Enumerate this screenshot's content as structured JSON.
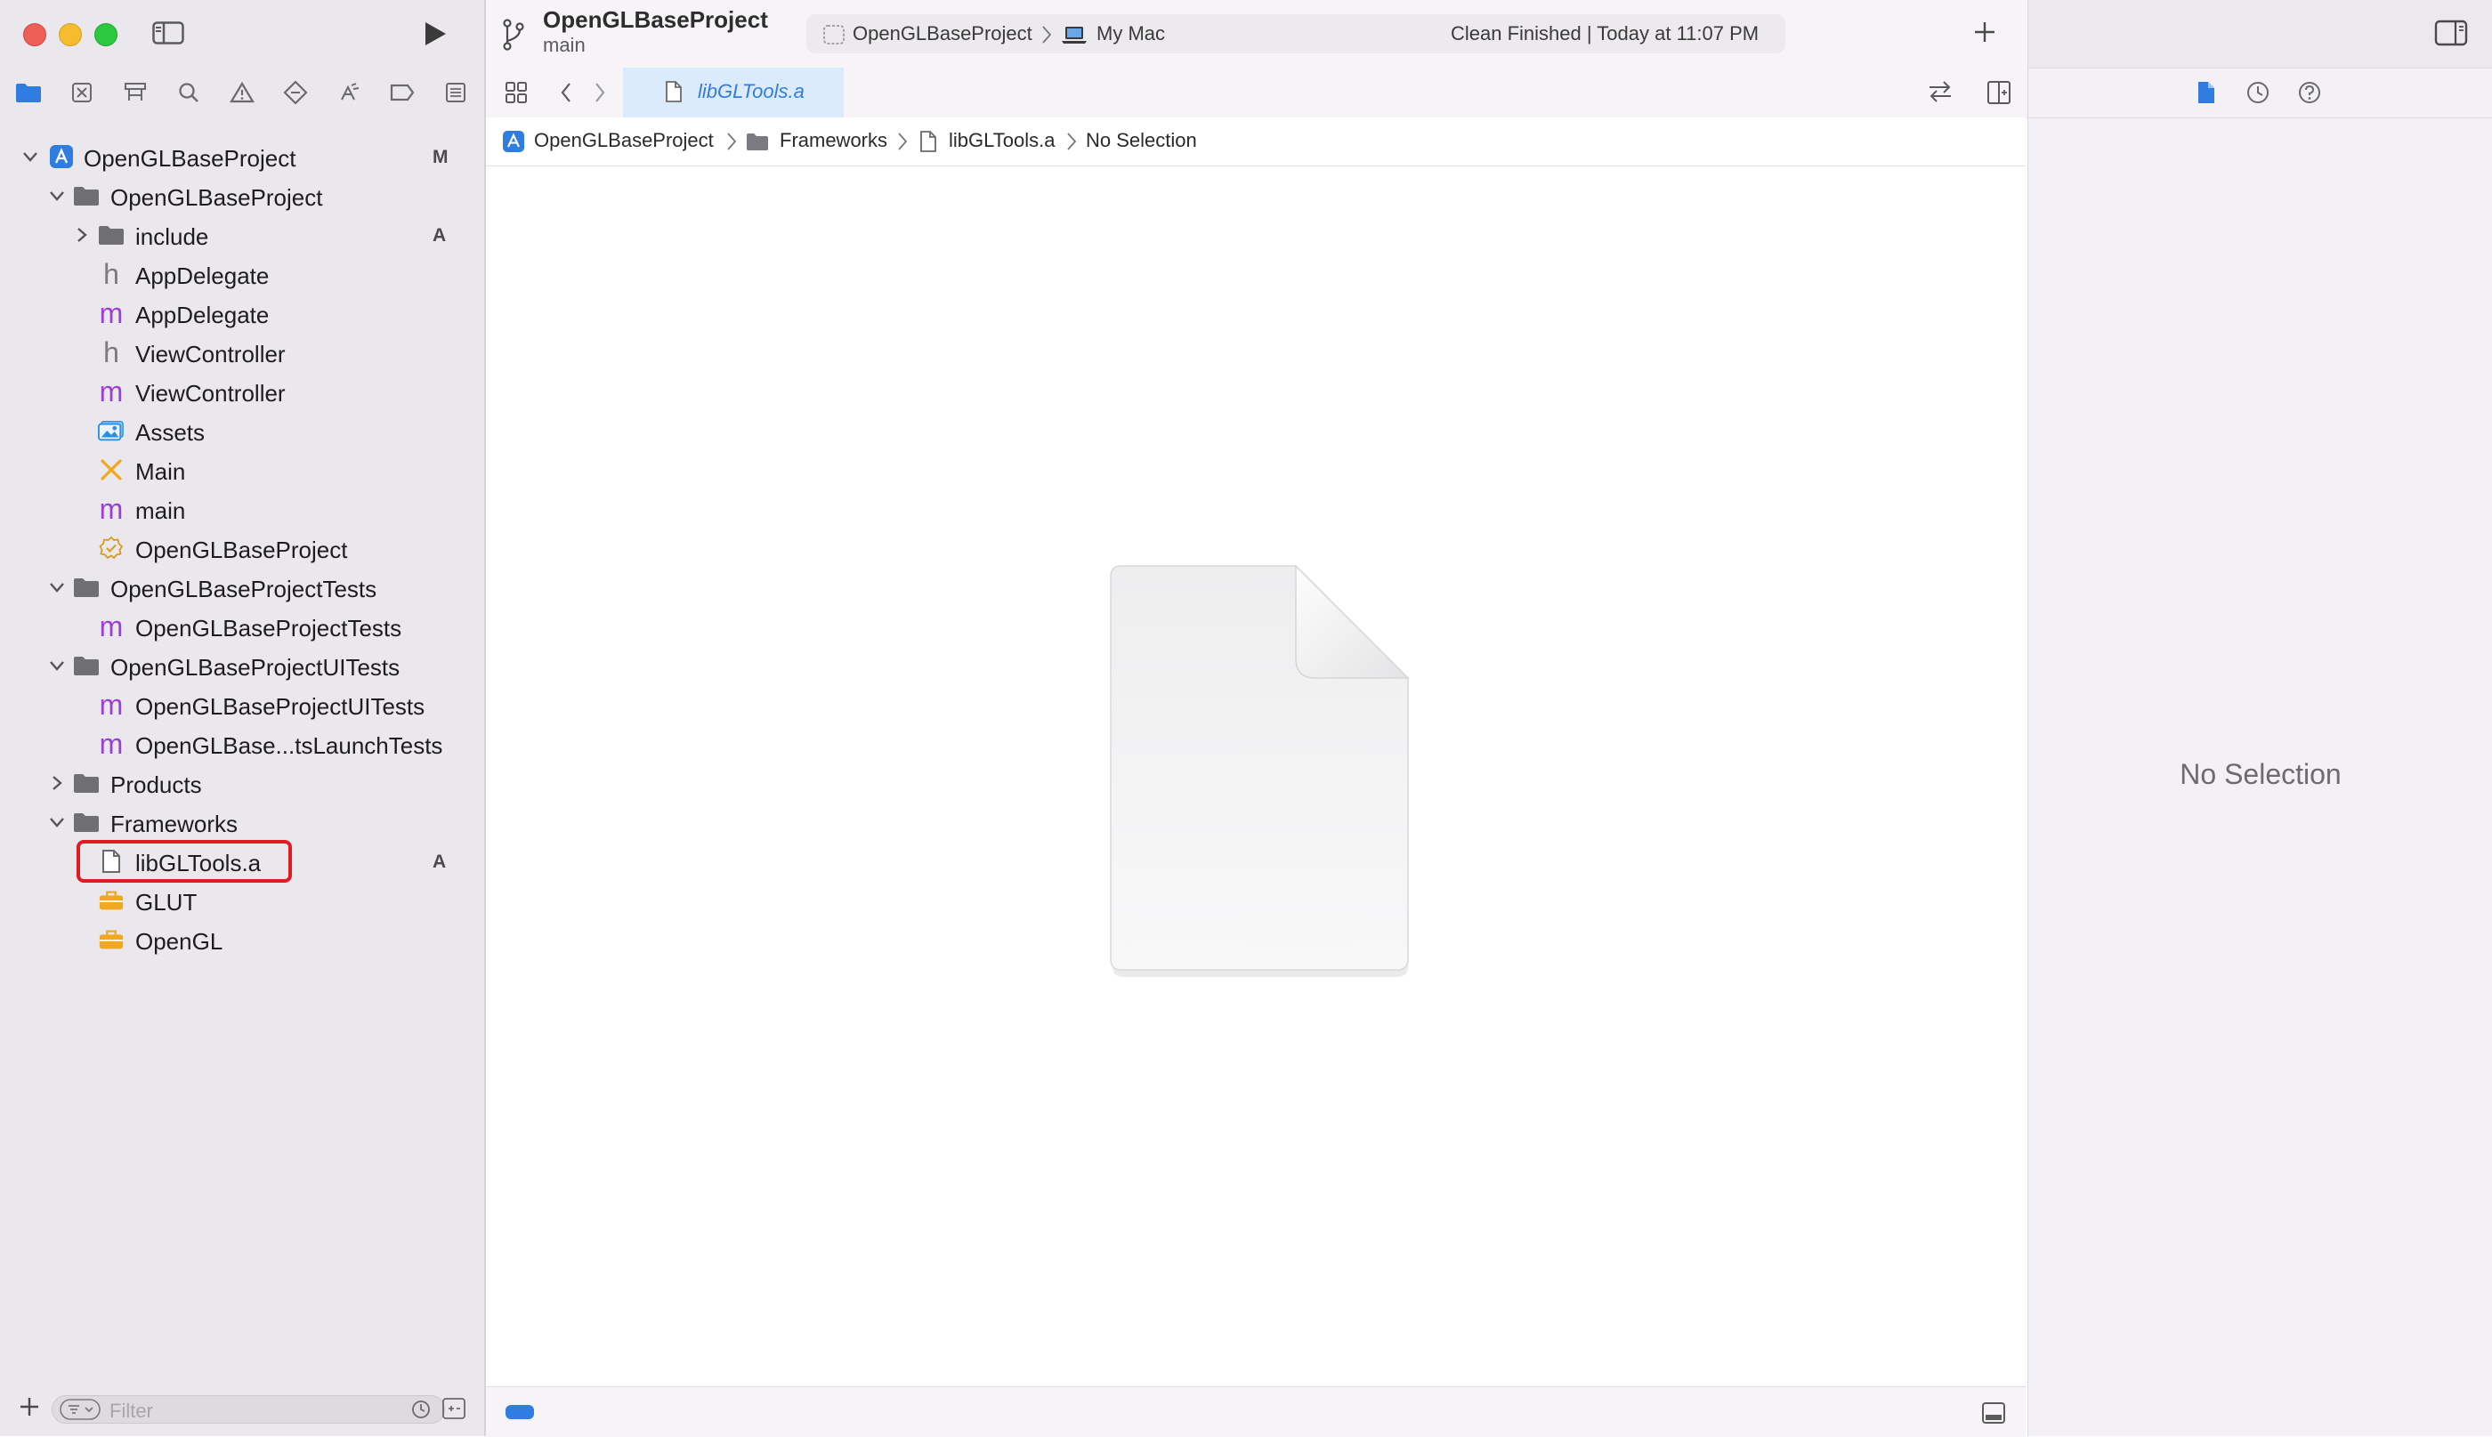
{
  "toolbar": {
    "project_title": "OpenGLBaseProject",
    "branch": "main",
    "scheme": "OpenGLBaseProject",
    "destination": "My Mac",
    "status": "Clean Finished | Today at 11:07 PM"
  },
  "tabbar": {
    "active_tab": "libGLTools.a"
  },
  "jumpbar": {
    "segments": [
      "OpenGLBaseProject",
      "Frameworks",
      "libGLTools.a",
      "No Selection"
    ]
  },
  "navigator": {
    "filter_placeholder": "Filter",
    "tree": [
      {
        "label": "OpenGLBaseProject",
        "icon": "project-icon",
        "badge": "M"
      },
      {
        "label": "OpenGLBaseProject",
        "icon": "folder-icon"
      },
      {
        "label": "include",
        "icon": "folder-icon",
        "badge": "A"
      },
      {
        "label": "AppDelegate",
        "icon": "header-file-icon"
      },
      {
        "label": "AppDelegate",
        "icon": "objc-file-icon"
      },
      {
        "label": "ViewController",
        "icon": "header-file-icon"
      },
      {
        "label": "ViewController",
        "icon": "objc-file-icon"
      },
      {
        "label": "Assets",
        "icon": "asset-catalog-icon"
      },
      {
        "label": "Main",
        "icon": "storyboard-icon"
      },
      {
        "label": "main",
        "icon": "objc-file-icon"
      },
      {
        "label": "OpenGLBaseProject",
        "icon": "entitlements-icon"
      },
      {
        "label": "OpenGLBaseProjectTests",
        "icon": "folder-icon"
      },
      {
        "label": "OpenGLBaseProjectTests",
        "icon": "objc-file-icon"
      },
      {
        "label": "OpenGLBaseProjectUITests",
        "icon": "folder-icon"
      },
      {
        "label": "OpenGLBaseProjectUITests",
        "icon": "objc-file-icon"
      },
      {
        "label": "OpenGLBase...tsLaunchTests",
        "icon": "objc-file-icon"
      },
      {
        "label": "Products",
        "icon": "folder-icon"
      },
      {
        "label": "Frameworks",
        "icon": "folder-icon"
      },
      {
        "label": "libGLTools.a",
        "icon": "file-icon",
        "badge": "A"
      },
      {
        "label": "GLUT",
        "icon": "framework-icon"
      },
      {
        "label": "OpenGL",
        "icon": "framework-icon"
      }
    ]
  },
  "inspector": {
    "empty_text": "No Selection"
  },
  "colors": {
    "accent": "#2f7de1",
    "highlight_box": "#e01b24",
    "objc_m": "#9c3fd6",
    "framework": "#f0a81e",
    "close": "#ee5f57",
    "minimize": "#f5bd2e",
    "zoom": "#2bc840"
  }
}
